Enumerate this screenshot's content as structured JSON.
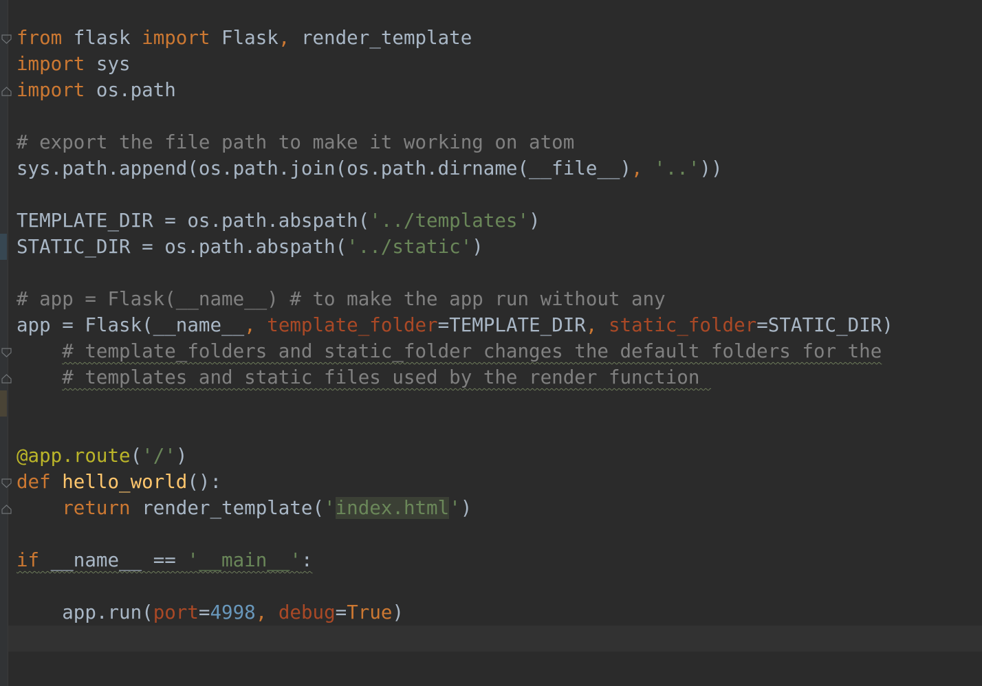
{
  "editor": {
    "colors": {
      "background": "#2b2b2b",
      "default_text": "#a9b7c6",
      "keyword": "#cc7832",
      "comment": "#808080",
      "string": "#6a8759",
      "number": "#6897bb",
      "parameter": "#aa4926",
      "decorator": "#bbb529",
      "function_name": "#ffc66d"
    },
    "lines": [
      {
        "tokens": [
          {
            "text": "from",
            "cls": "kw"
          },
          {
            "text": " flask ",
            "cls": ""
          },
          {
            "text": "import",
            "cls": "kw"
          },
          {
            "text": " Flask",
            "cls": ""
          },
          {
            "text": ",",
            "cls": "kw"
          },
          {
            "text": " render_template",
            "cls": ""
          }
        ]
      },
      {
        "tokens": [
          {
            "text": "import",
            "cls": "kw"
          },
          {
            "text": " sys",
            "cls": ""
          }
        ]
      },
      {
        "tokens": [
          {
            "text": "import",
            "cls": "kw"
          },
          {
            "text": " os.path",
            "cls": ""
          }
        ]
      },
      {
        "tokens": []
      },
      {
        "tokens": [
          {
            "text": "# export the file path to make it working on atom",
            "cls": "cm"
          }
        ]
      },
      {
        "tokens": [
          {
            "text": "sys.path.append(os.path.join(os.path.dirname(__file__)",
            "cls": ""
          },
          {
            "text": ", ",
            "cls": "kw"
          },
          {
            "text": "'..'",
            "cls": "str"
          },
          {
            "text": "))",
            "cls": ""
          }
        ]
      },
      {
        "tokens": []
      },
      {
        "tokens": [
          {
            "text": "TEMPLATE_DIR = os.path.abspath(",
            "cls": ""
          },
          {
            "text": "'../templates'",
            "cls": "str"
          },
          {
            "text": ")",
            "cls": ""
          }
        ]
      },
      {
        "tokens": [
          {
            "text": "STATIC_DIR = os.path.abspath(",
            "cls": ""
          },
          {
            "text": "'../static'",
            "cls": "str"
          },
          {
            "text": ")",
            "cls": ""
          }
        ]
      },
      {
        "tokens": []
      },
      {
        "tokens": [
          {
            "text": "# app = Flask(__name__) # to make the app run without any",
            "cls": "cm"
          }
        ]
      },
      {
        "tokens": [
          {
            "text": "app = Flask(__name__",
            "cls": ""
          },
          {
            "text": ", ",
            "cls": "kw"
          },
          {
            "text": "template_folder",
            "cls": "param"
          },
          {
            "text": "=TEMPLATE_DIR",
            "cls": ""
          },
          {
            "text": ", ",
            "cls": "kw"
          },
          {
            "text": "static_folder",
            "cls": "param"
          },
          {
            "text": "=STATIC_DIR)",
            "cls": ""
          }
        ]
      },
      {
        "tokens": [
          {
            "text": "    ",
            "cls": ""
          },
          {
            "text": "# template_folders and static_folder changes the default folders for the",
            "cls": "cm wavy"
          }
        ]
      },
      {
        "tokens": [
          {
            "text": "    ",
            "cls": ""
          },
          {
            "text": "# templates and static files used by the render function ",
            "cls": "cm wavy"
          }
        ]
      },
      {
        "tokens": []
      },
      {
        "tokens": []
      },
      {
        "tokens": [
          {
            "text": "@app.route",
            "cls": "deco"
          },
          {
            "text": "(",
            "cls": ""
          },
          {
            "text": "'/'",
            "cls": "str"
          },
          {
            "text": ")",
            "cls": ""
          }
        ]
      },
      {
        "tokens": [
          {
            "text": "def",
            "cls": "kw"
          },
          {
            "text": " ",
            "cls": ""
          },
          {
            "text": "hello_world",
            "cls": "fn"
          },
          {
            "text": "():",
            "cls": ""
          }
        ]
      },
      {
        "tokens": [
          {
            "text": "    ",
            "cls": ""
          },
          {
            "text": "return",
            "cls": "kw"
          },
          {
            "text": " render_template(",
            "cls": ""
          },
          {
            "text": "'",
            "cls": "str"
          },
          {
            "text": "index.html",
            "cls": "str hl-str"
          },
          {
            "text": "'",
            "cls": "str"
          },
          {
            "text": ")",
            "cls": ""
          }
        ]
      },
      {
        "tokens": []
      },
      {
        "tokens": [
          {
            "text": "if",
            "cls": "kw wavy"
          },
          {
            "text": " __name__ == ",
            "cls": "wavy"
          },
          {
            "text": "'__main__'",
            "cls": "str wavy"
          },
          {
            "text": ":",
            "cls": "wavy"
          }
        ]
      },
      {
        "tokens": []
      },
      {
        "tokens": [
          {
            "text": "    app.run(",
            "cls": ""
          },
          {
            "text": "port",
            "cls": "param"
          },
          {
            "text": "=",
            "cls": ""
          },
          {
            "text": "4998",
            "cls": "num"
          },
          {
            "text": ", ",
            "cls": "kw"
          },
          {
            "text": "debug",
            "cls": "param"
          },
          {
            "text": "=",
            "cls": ""
          },
          {
            "text": "True",
            "cls": "kw"
          },
          {
            "text": ")",
            "cls": ""
          }
        ]
      },
      {
        "tokens": []
      }
    ]
  }
}
